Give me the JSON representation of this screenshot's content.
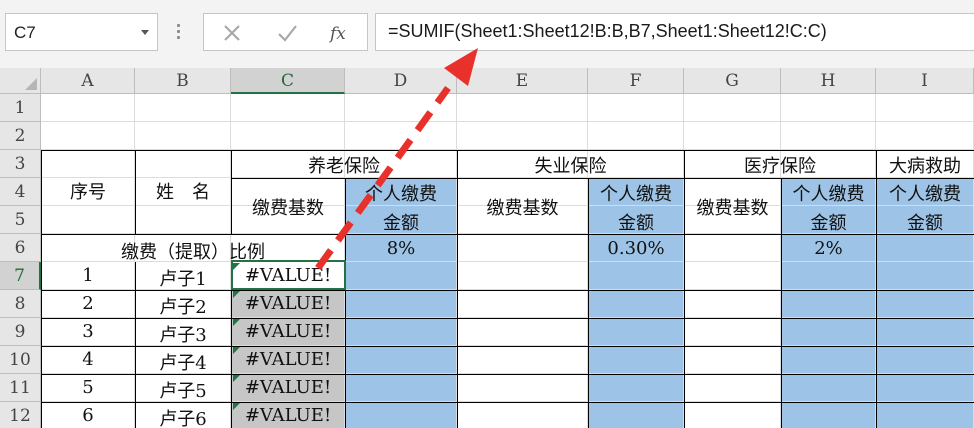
{
  "formula_bar": {
    "name_box": "C7",
    "cancel_icon": "×",
    "enter_icon": "✓",
    "fx_label": "fx",
    "formula": "=SUMIF(Sheet1:Sheet12!B:B,B7,Sheet1:Sheet12!C:C)"
  },
  "columns": [
    "A",
    "B",
    "C",
    "D",
    "E",
    "F",
    "G",
    "H",
    "I"
  ],
  "rows": [
    "1",
    "2",
    "3",
    "4",
    "5",
    "6",
    "7",
    "8",
    "9",
    "10",
    "11",
    "12"
  ],
  "selected_cell": "C7",
  "headers": {
    "seq": "序号",
    "name": "姓　名",
    "pension": "养老保险",
    "unemployment": "失业保险",
    "medical": "医疗保险",
    "serious_illness": "大病救助",
    "base": "缴费基数",
    "personal_line1": "个人缴费",
    "personal_line2": "金额",
    "ratio_label": "缴费（提取）比例"
  },
  "ratios": {
    "pension": "8%",
    "unemployment": "0.30%",
    "medical": "2%"
  },
  "data_rows": [
    {
      "seq": "1",
      "name": "卢子1",
      "value": "#VALUE!"
    },
    {
      "seq": "2",
      "name": "卢子2",
      "value": "#VALUE!"
    },
    {
      "seq": "3",
      "name": "卢子3",
      "value": "#VALUE!"
    },
    {
      "seq": "4",
      "name": "卢子4",
      "value": "#VALUE!"
    },
    {
      "seq": "5",
      "name": "卢子5",
      "value": "#VALUE!"
    },
    {
      "seq": "6",
      "name": "卢子6",
      "value": "#VALUE!"
    }
  ],
  "colors": {
    "accent": "#217346",
    "highlight_blue": "#9dc3e6",
    "error_gray": "#c6c6c6",
    "annotation_arrow": "#e8312b"
  }
}
